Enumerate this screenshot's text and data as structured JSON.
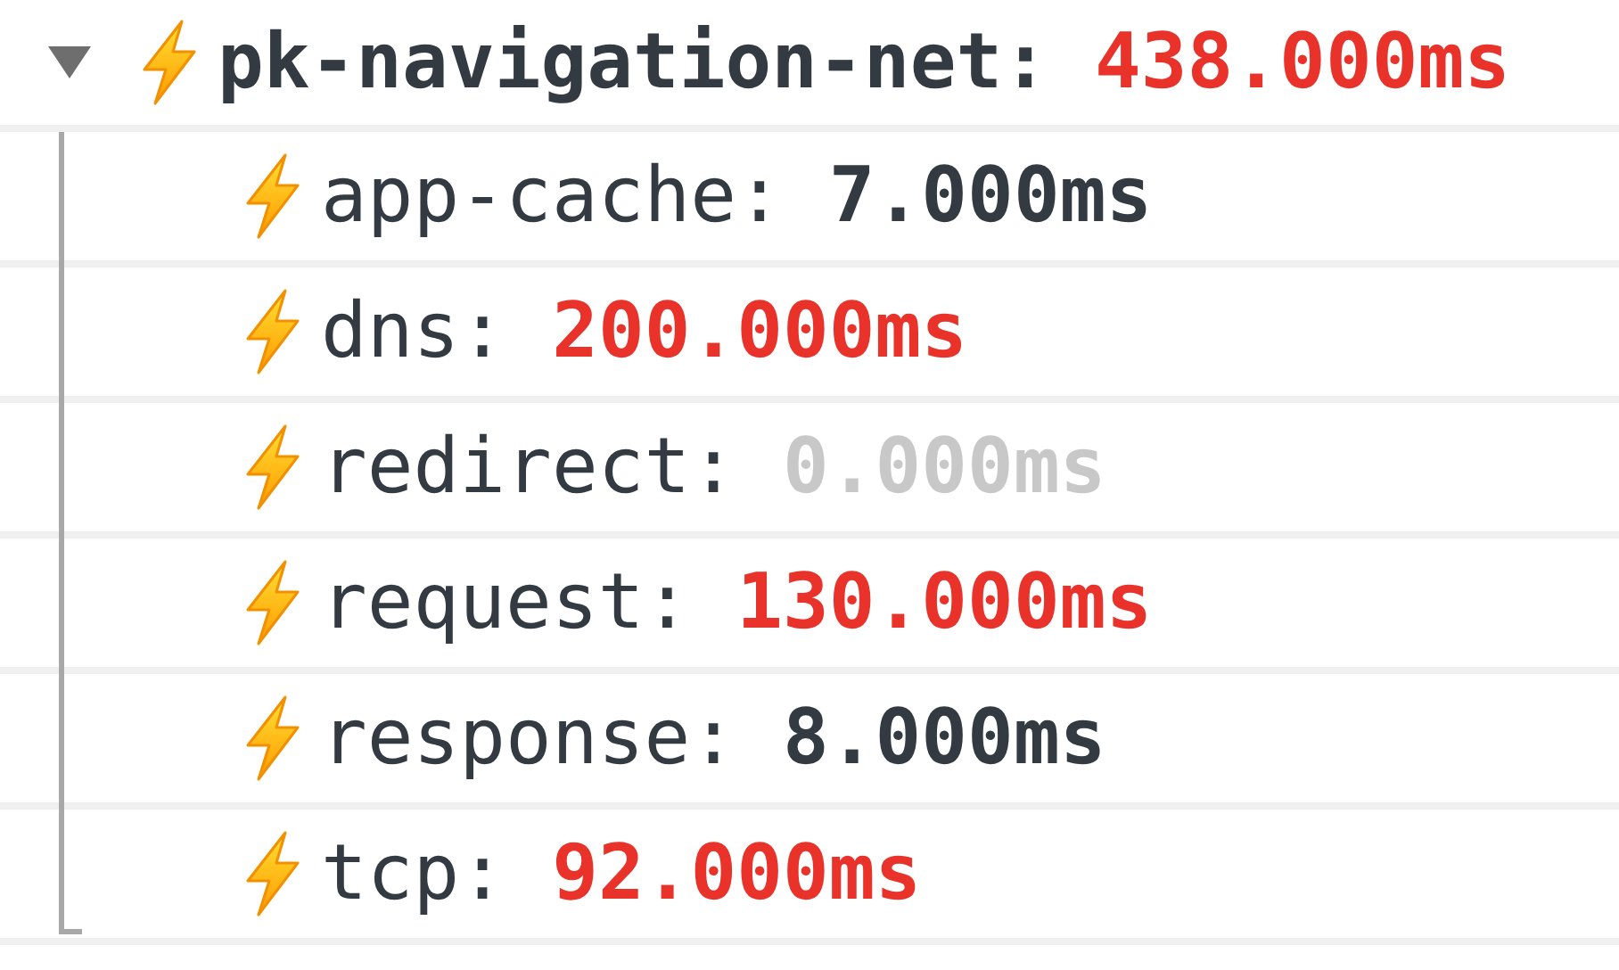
{
  "group": {
    "label": "pk-navigation-net:",
    "value": "438.000ms",
    "color": "#e8322a",
    "expanded": true,
    "children": [
      {
        "label": "app-cache:",
        "value": "7.000ms",
        "color": "#333a42"
      },
      {
        "label": "dns:",
        "value": "200.000ms",
        "color": "#e8322a"
      },
      {
        "label": "redirect:",
        "value": "0.000ms",
        "color": "#c8c8c8"
      },
      {
        "label": "request:",
        "value": "130.000ms",
        "color": "#e8322a"
      },
      {
        "label": "response:",
        "value": "8.000ms",
        "color": "#333a42"
      },
      {
        "label": "tcp:",
        "value": "92.000ms",
        "color": "#e8322a"
      }
    ]
  }
}
